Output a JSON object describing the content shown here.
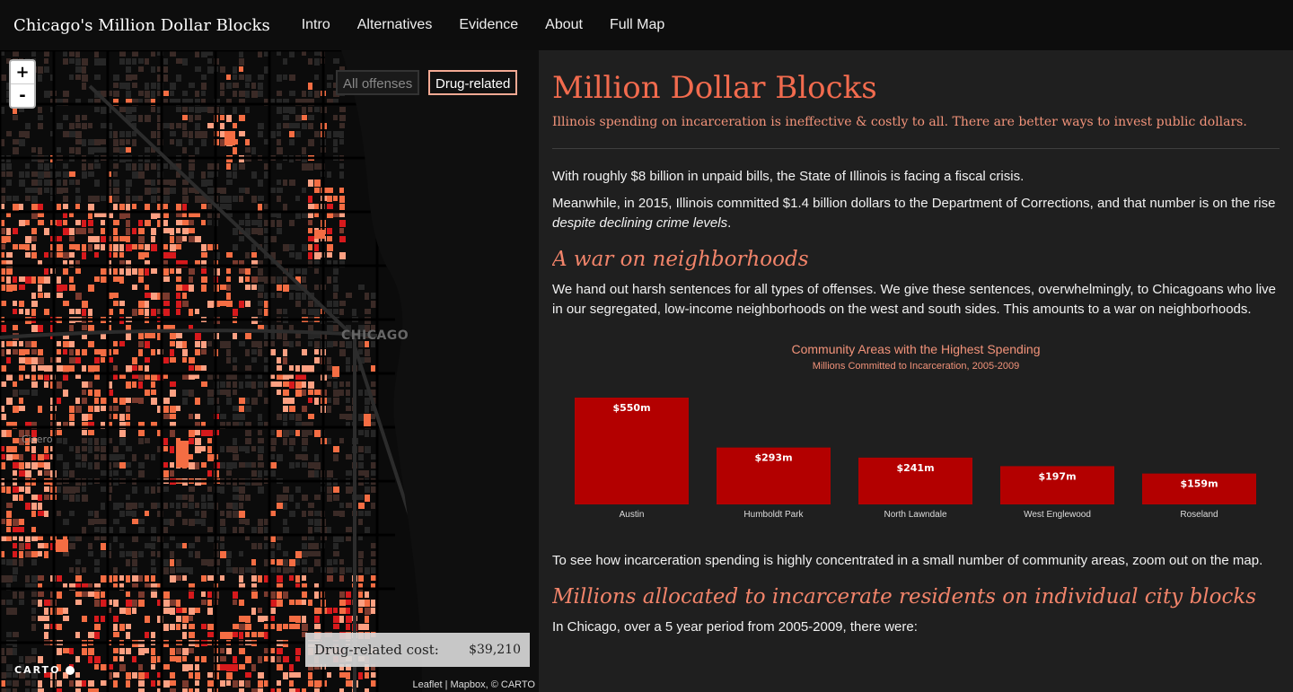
{
  "navbar": {
    "brand": "Chicago's Million Dollar Blocks",
    "items": [
      "Intro",
      "Alternatives",
      "Evidence",
      "About",
      "Full Map"
    ]
  },
  "map": {
    "zoom_in": "+",
    "zoom_out": "-",
    "toggle_all": "All offenses",
    "toggle_drug": "Drug-related",
    "cost_label": "Drug-related cost:",
    "cost_value": "$39,210",
    "city_label": "CHICAGO",
    "suburb_label": "Cicero",
    "carto_logo": "CARTO",
    "attribution": "Leaflet | Mapbox, © CARTO"
  },
  "content": {
    "title": "Million Dollar Blocks",
    "subtitle": "Illinois spending on incarceration is ineffective & costly to all. There are better ways to invest public dollars.",
    "p1": "With roughly $8 billion in unpaid bills, the State of Illinois is facing a fiscal crisis.",
    "p2_pre": "Meanwhile, in 2015, Illinois committed $1.4 billion dollars to the Department of Corrections, and that number is on the rise ",
    "p2_em": "despite declining crime levels",
    "p2_post": ".",
    "h2_a": "A war on neighborhoods",
    "p3": "We hand out harsh sentences for all types of offenses. We give these sentences, overwhelmingly, to Chicagoans who live in our segregated, low-income neighborhoods on the west and south sides. This amounts to a war on neighborhoods.",
    "p4": "To see how incarceration spending is highly concentrated in a small number of community areas, zoom out on the map.",
    "h2_b": "Millions allocated to incarcerate residents on individual city blocks",
    "p5": "In Chicago, over a 5 year period from 2005-2009, there were:"
  },
  "colors": {
    "accent": "#f26b4e",
    "bar": "#b30000",
    "nav_bg": "#0d0d0d",
    "page_bg": "#1f1f1f"
  },
  "chart_data": {
    "type": "bar",
    "title": "Community Areas with the Highest Spending",
    "subtitle": "Millions Committed to Incarceration, 2005-2009",
    "categories": [
      "Austin",
      "Humboldt Park",
      "North Lawndale",
      "West Englewood",
      "Roseland"
    ],
    "values": [
      550,
      293,
      241,
      197,
      159
    ],
    "labels": [
      "$550m",
      "$293m",
      "$241m",
      "$197m",
      "$159m"
    ],
    "ylim": [
      0,
      550
    ]
  }
}
